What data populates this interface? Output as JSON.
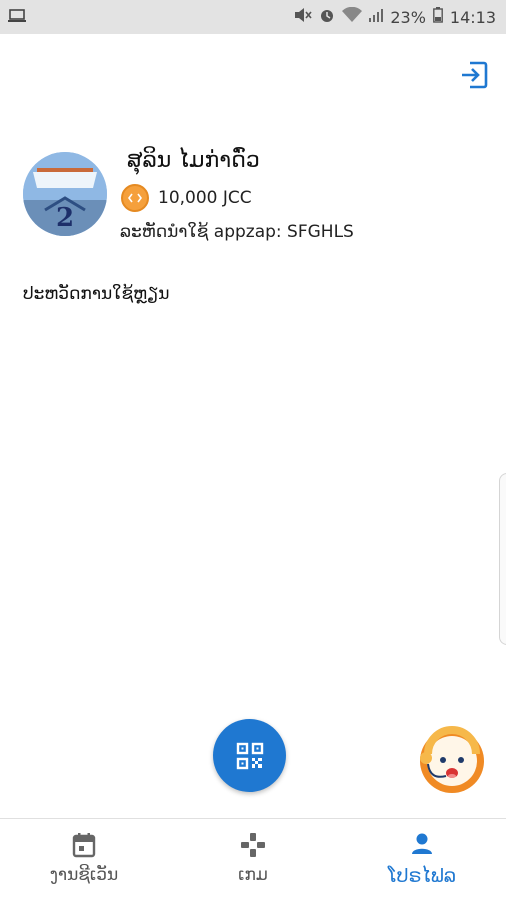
{
  "status_bar": {
    "battery_percent": "23%",
    "time": "14:13"
  },
  "profile": {
    "name": "ສຸລິນ ໄມກ່າດົ່ວ",
    "coins": "10,000 JCC",
    "referral_code": "ລະຫັດນຳໃຊ້ appzap: SFGHLS",
    "history_title": "ປະຫວັດການໃຊ້ຫຼຽນ"
  },
  "bottom_nav": {
    "items": [
      {
        "label": "ງານຊີເວັນ",
        "icon": "calendar-icon"
      },
      {
        "label": "ເກມ",
        "icon": "gamepad-icon"
      },
      {
        "label": "ໂປຣໄຟລ",
        "icon": "person-icon"
      }
    ],
    "active_index": 2
  },
  "colors": {
    "accent": "#1f78d1",
    "coin": "#f5a03c",
    "status_bar_bg": "#e3e3e3"
  }
}
